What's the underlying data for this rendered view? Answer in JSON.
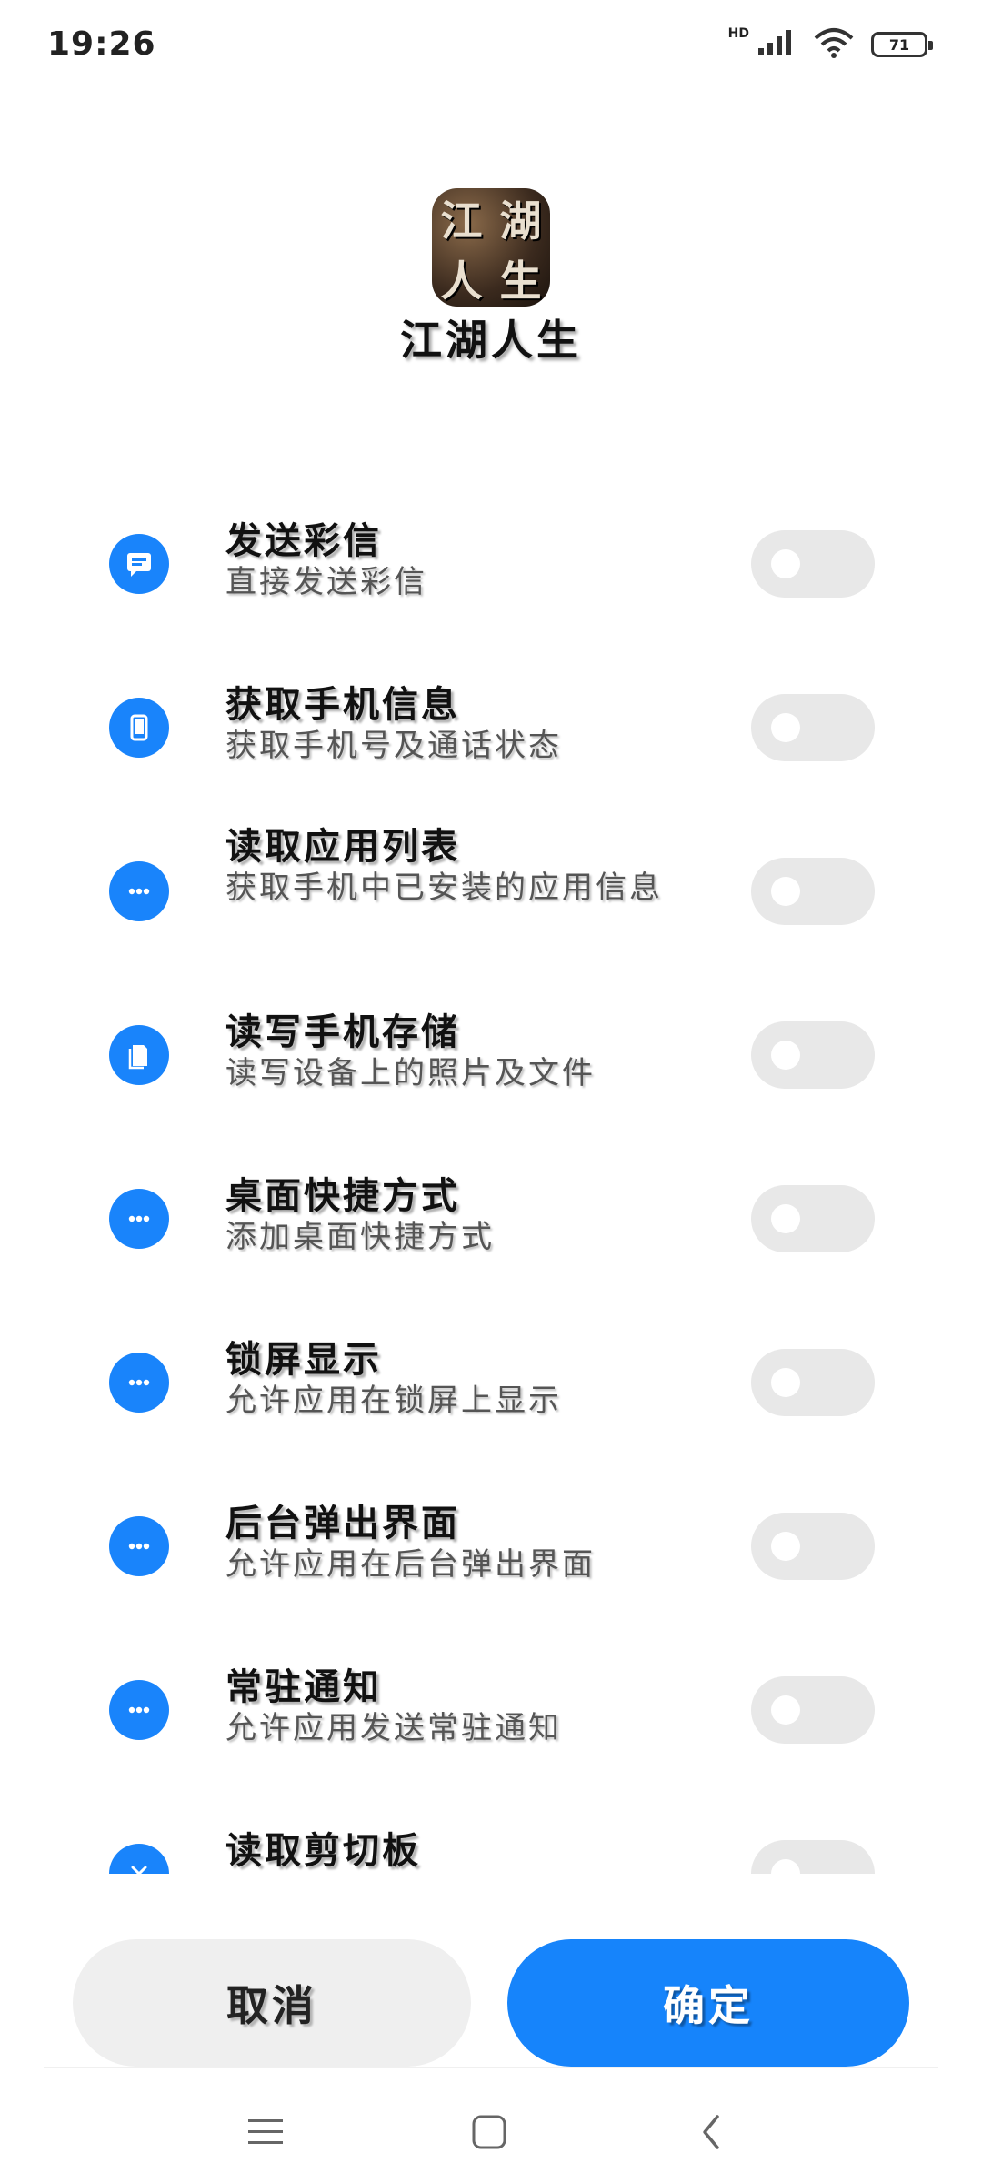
{
  "status_bar": {
    "time": "19:26",
    "network_badge": "HD",
    "battery_level": "71",
    "icons": [
      "signal-icon",
      "wifi-icon",
      "battery-icon"
    ]
  },
  "app": {
    "icon_glyphs": [
      "江",
      "湖",
      "人",
      "生"
    ],
    "name": "江湖人生"
  },
  "permissions": [
    {
      "title": "发送彩信",
      "description": "直接发送彩信",
      "icon": "message-icon",
      "enabled": false
    },
    {
      "title": "获取手机信息",
      "description": "获取手机号及通话状态",
      "icon": "phone-icon",
      "enabled": false
    },
    {
      "title": "读取应用列表",
      "description": "获取手机中已安装的应用信息",
      "icon": "more-icon",
      "enabled": false
    },
    {
      "title": "读写手机存储",
      "description": "读写设备上的照片及文件",
      "icon": "storage-icon",
      "enabled": false
    },
    {
      "title": "桌面快捷方式",
      "description": "添加桌面快捷方式",
      "icon": "more-icon",
      "enabled": false
    },
    {
      "title": "锁屏显示",
      "description": "允许应用在锁屏上显示",
      "icon": "more-icon",
      "enabled": false
    },
    {
      "title": "后台弹出界面",
      "description": "允许应用在后台弹出界面",
      "icon": "more-icon",
      "enabled": false
    },
    {
      "title": "常驻通知",
      "description": "允许应用发送常驻通知",
      "icon": "more-icon",
      "enabled": false
    },
    {
      "title": "读取剪切板",
      "description": "",
      "icon": "close-icon",
      "enabled": false
    }
  ],
  "buttons": {
    "cancel_label": "取消",
    "confirm_label": "确定"
  },
  "nav_bar": {
    "icons": [
      "menu-icon",
      "home-icon",
      "back-icon"
    ]
  },
  "colors": {
    "accent": "#1684fb",
    "toggle_off": "#e8e8e8",
    "cancel_bg": "#efefef"
  }
}
